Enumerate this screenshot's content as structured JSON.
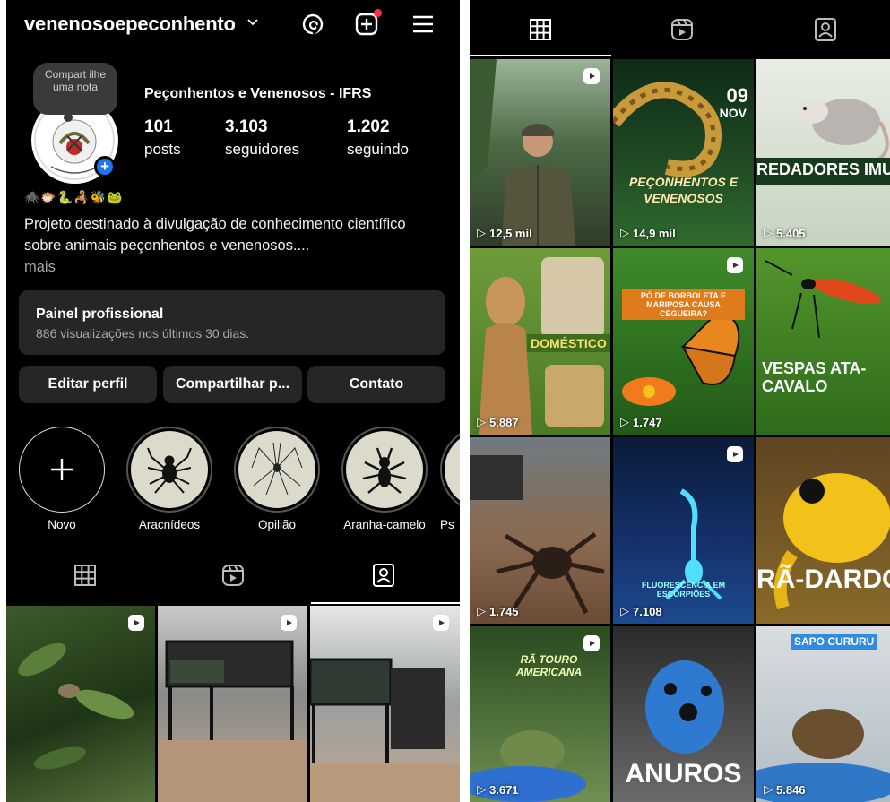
{
  "left": {
    "username": "venenosoepeconhento",
    "note": "Compart ilhe uma nota",
    "full_name": "Peçonhentos e Venenosos - IFRS",
    "stats": [
      {
        "num": "101",
        "lbl": "posts"
      },
      {
        "num": "3.103",
        "lbl": "seguidores"
      },
      {
        "num": "1.202",
        "lbl": "seguindo"
      }
    ],
    "emojis": "🕷️🐡🐍🦂🐝🐸",
    "bio": "Projeto destinado à divulgação de conhecimento científico sobre  animais peçonhentos e venenosos....",
    "bio_more": "mais",
    "pro_title": "Painel profissional",
    "pro_sub": "886 visualizações nos últimos 30 dias.",
    "buttons": [
      "Editar perfil",
      "Compartilhar p...",
      "Contato"
    ],
    "highlights": [
      "Novo",
      "Aracnídeos",
      "Opilião",
      "Aranha-camelo",
      "Ps"
    ]
  },
  "right": {
    "tiles": [
      {
        "views": "12,5 mil"
      },
      {
        "views": "14,9 mil",
        "date_day": "09",
        "date_month": "NOV",
        "caption": "PEÇONHENTOS E VENENOSOS"
      },
      {
        "views": "5.405",
        "caption": "REDADORES IMUN"
      },
      {
        "views": "5.887",
        "caption": "DOMÉSTICO"
      },
      {
        "views": "1.747",
        "caption": "PÓ DE BORBOLETA E MARIPOSA CAUSA CEGUEIRA?"
      },
      {
        "views": "",
        "caption": "VESPAS ATA-CAVALO"
      },
      {
        "views": "1.745"
      },
      {
        "views": "7.108",
        "caption": "FLUORESCÊNCIA EM ESCORPIÕES"
      },
      {
        "views": "",
        "caption": "RÃ-DARDO"
      },
      {
        "views": "3.671",
        "caption": "RÃ TOURO AMERICANA"
      },
      {
        "views": "",
        "caption": "ANUROS"
      },
      {
        "views": "5.846",
        "caption": "SAPO CURURU"
      }
    ]
  },
  "colors": {
    "bg": "#000000",
    "card": "#262626",
    "accent": "#1877f2",
    "notify": "#ff2d4a"
  }
}
